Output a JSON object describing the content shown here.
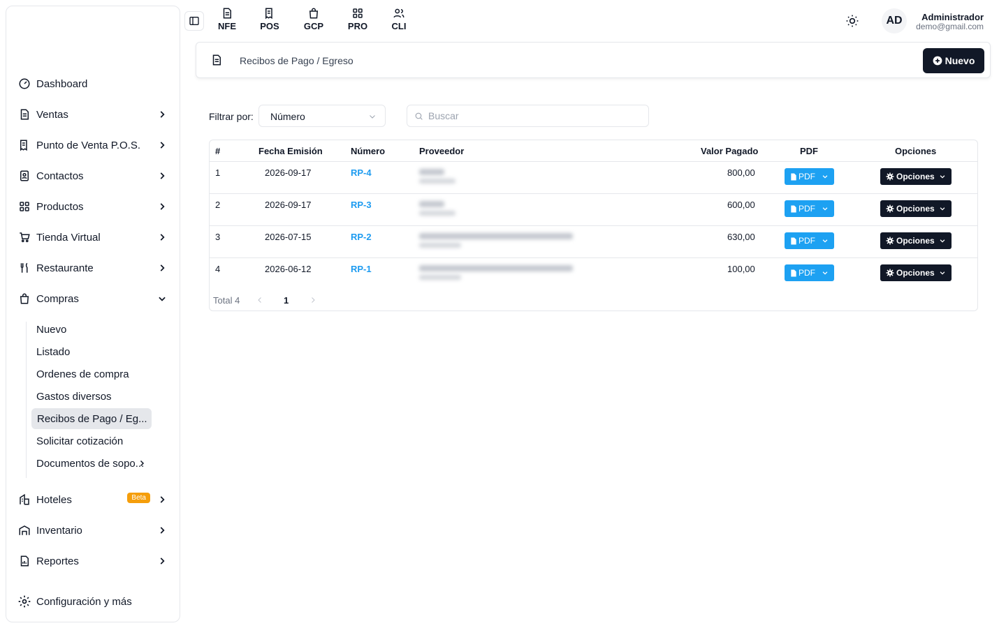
{
  "sidebar": {
    "items": [
      {
        "label": "Dashboard"
      },
      {
        "label": "Ventas"
      },
      {
        "label": "Punto de Venta P.O.S."
      },
      {
        "label": "Contactos"
      },
      {
        "label": "Productos"
      },
      {
        "label": "Tienda Virtual"
      },
      {
        "label": "Restaurante"
      },
      {
        "label": "Compras"
      },
      {
        "label": "Hoteles",
        "badge": "Beta"
      },
      {
        "label": "Inventario"
      },
      {
        "label": "Reportes"
      },
      {
        "label": "Configuración y más"
      }
    ],
    "compras_sub": [
      {
        "label": "Nuevo"
      },
      {
        "label": "Listado"
      },
      {
        "label": "Ordenes de compra"
      },
      {
        "label": "Gastos diversos"
      },
      {
        "label": "Recibos de Pago / Eg..."
      },
      {
        "label": "Solicitar cotización"
      },
      {
        "label": "Documentos de sopo..."
      }
    ]
  },
  "topbar": {
    "apps": [
      {
        "label": "NFE",
        "icon": "document-icon"
      },
      {
        "label": "POS",
        "icon": "receipt-icon"
      },
      {
        "label": "GCP",
        "icon": "bag-icon"
      },
      {
        "label": "PRO",
        "icon": "grid-icon"
      },
      {
        "label": "CLI",
        "icon": "users-icon"
      }
    ],
    "avatar": "AD",
    "user_name": "Administrador",
    "user_email": "demo@gmail.com"
  },
  "header": {
    "title": "Recibos de Pago / Egreso",
    "new_label": "Nuevo"
  },
  "filter": {
    "label": "Filtrar por:",
    "selected": "Número",
    "search_placeholder": "Buscar"
  },
  "table": {
    "columns": [
      "#",
      "Fecha Emisión",
      "Número",
      "Proveedor",
      "Valor Pagado",
      "PDF",
      "Opciones"
    ],
    "rows": [
      {
        "idx": "1",
        "date": "2026-09-17",
        "number": "RP-4",
        "amount": "800,00"
      },
      {
        "idx": "2",
        "date": "2026-09-17",
        "number": "RP-3",
        "amount": "600,00"
      },
      {
        "idx": "3",
        "date": "2026-07-15",
        "number": "RP-2",
        "amount": "630,00"
      },
      {
        "idx": "4",
        "date": "2026-06-12",
        "number": "RP-1",
        "amount": "100,00"
      }
    ],
    "pdf_label": "PDF",
    "options_label": "Opciones"
  },
  "pager": {
    "total": "Total 4",
    "page": "1"
  },
  "colors": {
    "accent": "#1da1f2",
    "dark": "#111827"
  }
}
